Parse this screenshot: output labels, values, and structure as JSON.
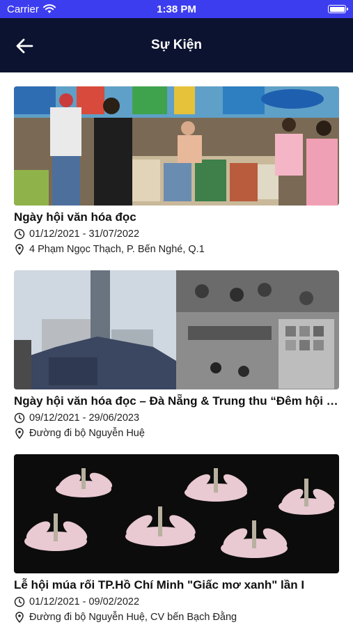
{
  "status_bar": {
    "carrier": "Carrier",
    "time": "1:38 PM"
  },
  "nav": {
    "title": "Sự Kiện"
  },
  "events": [
    {
      "title": "Ngày hội văn hóa đọc",
      "date_range": "01/12/2021 - 31/07/2022",
      "location": "4 Phạm Ngọc Thạch, P. Bến Nghé, Q.1"
    },
    {
      "title": "Ngày hội văn hóa đọc – Đà Nẵng & Trung thu “Đêm hội trăng rằm”",
      "date_range": "09/12/2021 - 29/06/2023",
      "location": "Đường đi bộ Nguyễn Huệ"
    },
    {
      "title": "Lễ hội múa rối TP.Hồ Chí Minh \"Giấc mơ xanh\" lần I",
      "date_range": "01/12/2021 - 09/02/2022",
      "location": "Đường đi bộ Nguyễn Huệ, CV bến Bạch Đằng"
    }
  ],
  "icons": {
    "back": "arrow-left-icon",
    "clock": "clock-icon",
    "pin": "location-pin-icon",
    "wifi": "wifi-icon",
    "battery": "battery-icon"
  },
  "colors": {
    "status_bar": "#3d3df0",
    "nav_bar": "#0b1330"
  }
}
